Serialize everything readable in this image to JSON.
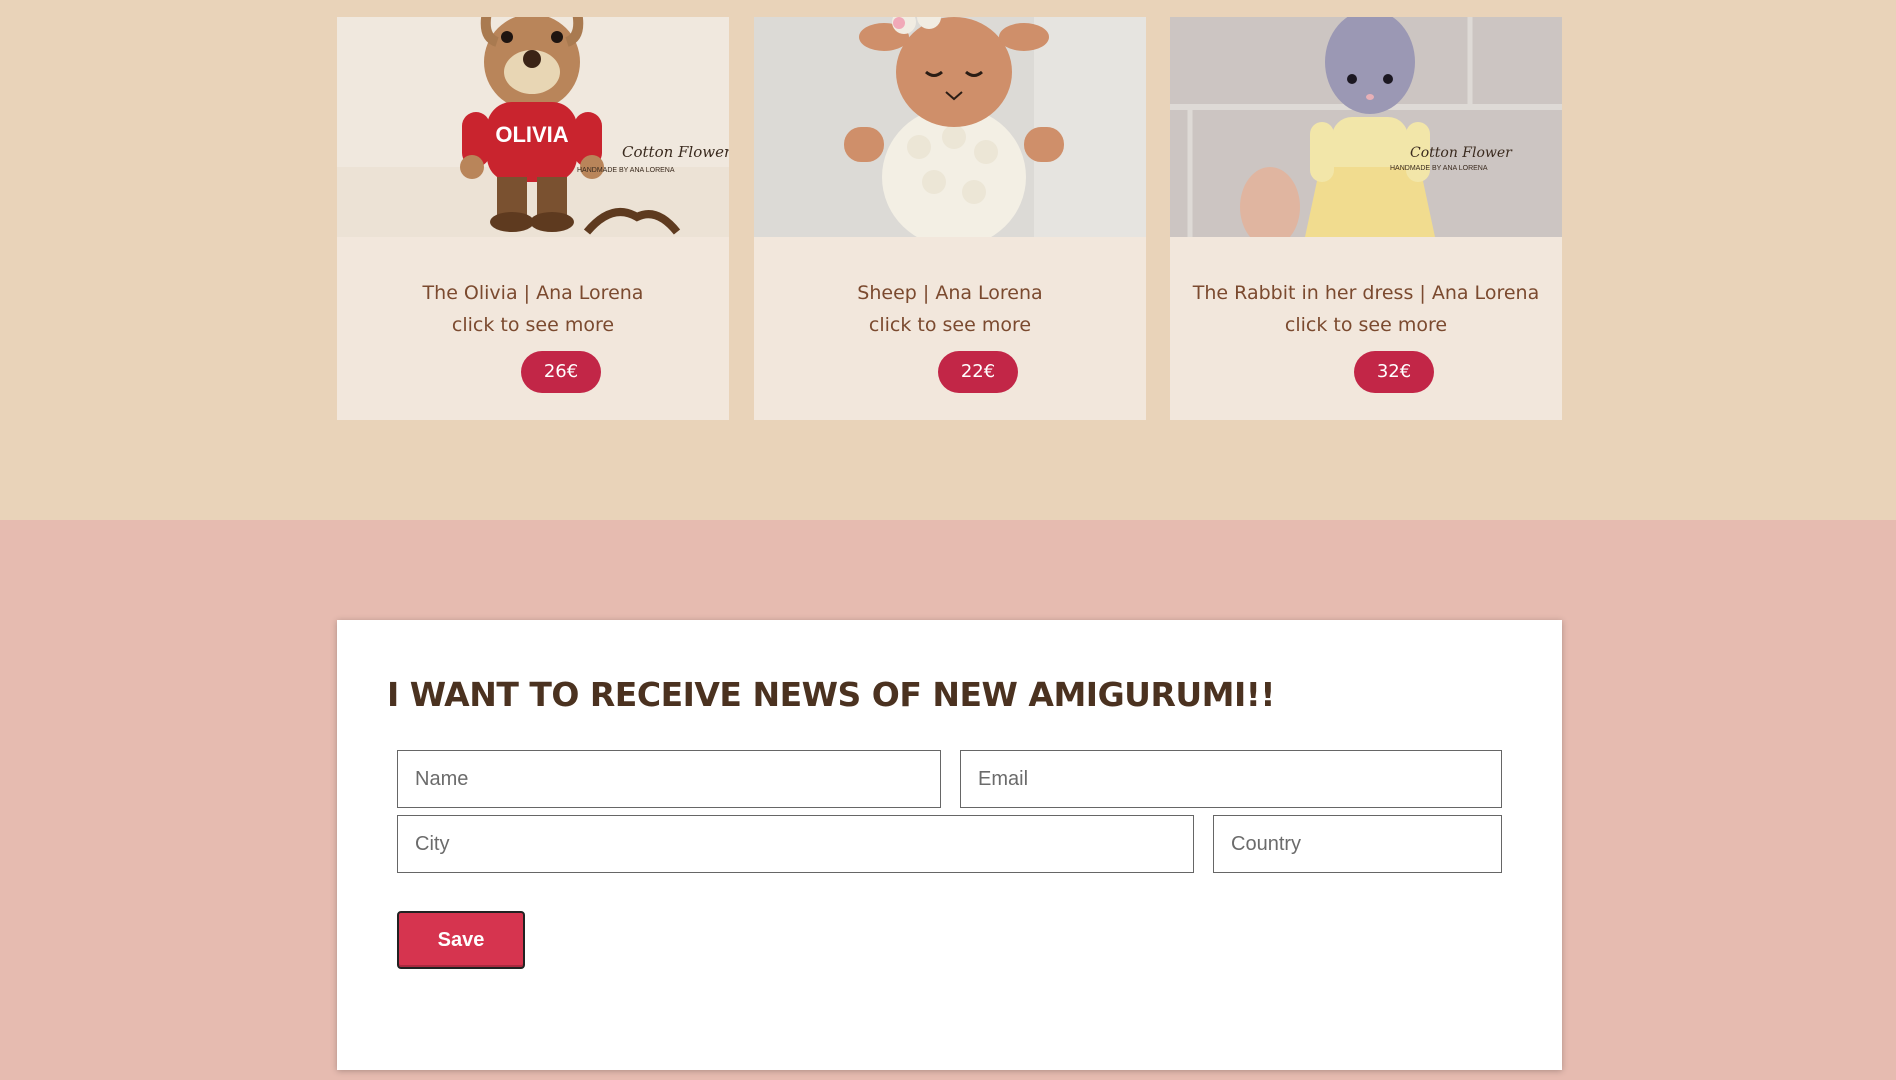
{
  "products": [
    {
      "title": "The Olivia | Ana Lorena",
      "more": "click to see more",
      "price": "26€",
      "watermark": "Cotton Flower",
      "watermark_sub": "HANDMADE BY ANA LORENA"
    },
    {
      "title": "Sheep | Ana Lorena",
      "more": "click to see more",
      "price": "22€"
    },
    {
      "title": "The Rabbit in her dress | Ana Lorena",
      "more": "click to see more",
      "price": "32€",
      "watermark": "Cotton Flower",
      "watermark_sub": "HANDMADE BY ANA LORENA"
    }
  ],
  "newsletter": {
    "title": "I WANT TO RECEIVE NEWS OF NEW AMIGURUMI!!",
    "name_placeholder": "Name",
    "email_placeholder": "Email",
    "city_placeholder": "City",
    "country_placeholder": "Country",
    "save_label": "Save"
  },
  "colors": {
    "top_bg": "#e9d3b9",
    "bottom_bg": "#e6bbb0",
    "card_bg": "#f2e7dc",
    "price_bg": "#c22647",
    "text_brown": "#7b4a2f",
    "save_bg": "#d6344f"
  }
}
